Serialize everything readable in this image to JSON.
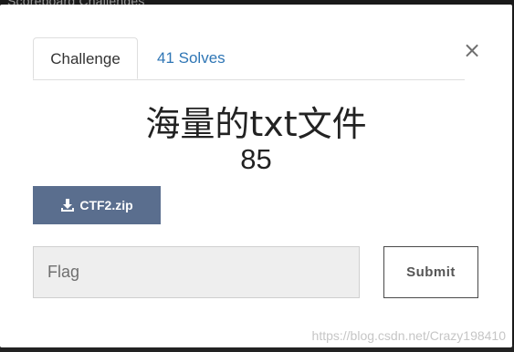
{
  "backdrop": {
    "breadcrumb": "Scoreboard   Challenges"
  },
  "modal": {
    "close_glyph": "×",
    "tabs": [
      {
        "label": "Challenge"
      },
      {
        "label": "41 Solves"
      }
    ],
    "challenge_name": "海量的txt文件",
    "challenge_value": "85",
    "download": {
      "label": "CTF2.zip",
      "icon": "download-icon"
    },
    "flag_input": {
      "placeholder": "Flag",
      "value": ""
    },
    "submit_label": "Submit"
  },
  "watermark": "https://blog.csdn.net/Crazy198410",
  "colors": {
    "download_button": "#5a6e8e",
    "tab_link": "#2f76b5",
    "input_bg": "#eeeeee"
  }
}
